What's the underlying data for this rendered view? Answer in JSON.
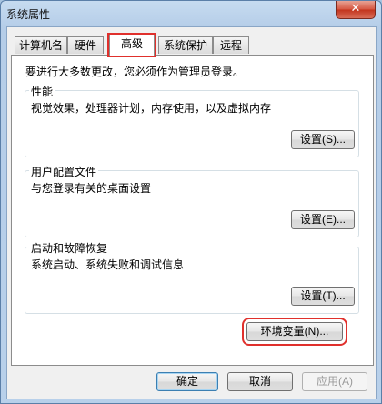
{
  "window": {
    "title": "系统属性",
    "close_symbol": "✕"
  },
  "tabs": [
    {
      "label": "计算机名"
    },
    {
      "label": "硬件"
    },
    {
      "label": "高级"
    },
    {
      "label": "系统保护"
    },
    {
      "label": "远程"
    }
  ],
  "active_tab": "高级",
  "notice": "要进行大多数更改，您必须作为管理员登录。",
  "groups": [
    {
      "title": "性能",
      "description": "视觉效果，处理器计划，内存使用，以及虚拟内存",
      "button": "设置(S)..."
    },
    {
      "title": "用户配置文件",
      "description": "与您登录有关的桌面设置",
      "button": "设置(E)..."
    },
    {
      "title": "启动和故障恢复",
      "description": "系统启动、系统失败和调试信息",
      "button": "设置(T)..."
    }
  ],
  "env_button": "环境变量(N)...",
  "footer": {
    "ok": "确定",
    "cancel": "取消",
    "apply": "应用(A)"
  },
  "colors": {
    "highlight": "#e0302c",
    "titlebar": "#b5cde8"
  }
}
